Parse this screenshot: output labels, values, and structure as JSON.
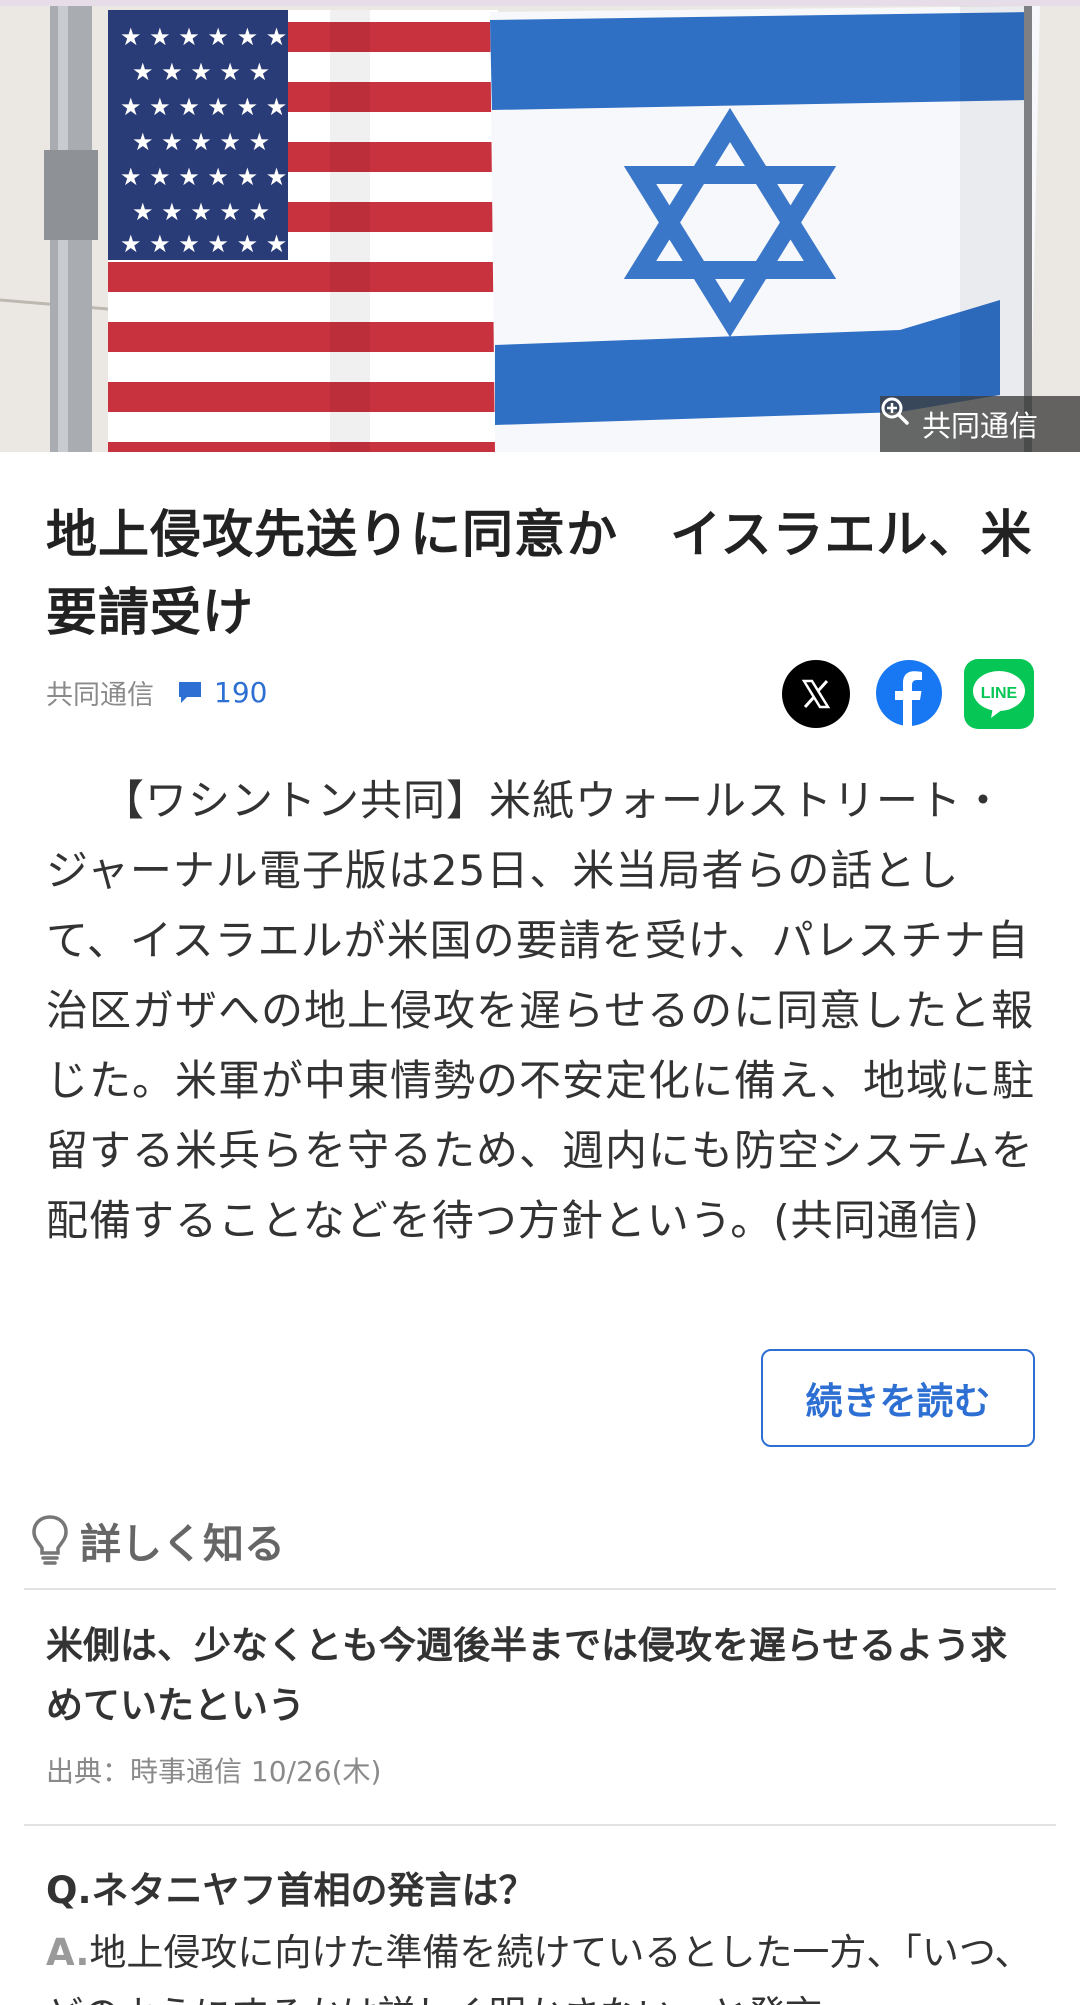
{
  "hero": {
    "credit": "共同通信",
    "colors": {
      "us_red": "#c8323e",
      "us_blue": "#2a3c78",
      "israel_blue": "#2f6fc4"
    }
  },
  "article": {
    "title": "地上侵攻先送りに同意か　イスラエル、米要請受け",
    "source": "共同通信",
    "comment_count": "190",
    "body": "【ワシントン共同】米紙ウォールストリート・ジャーナル電子版は25日、米当局者らの話として、イスラエルが米国の要請を受け、パレスチナ自治区ガザへの地上侵攻を遅らせるのに同意したと報じた。米軍が中東情勢の不安定化に備え、地域に駐留する米兵らを守るため、週内にも防空システムを配備することなどを待つ方針という。(共同通信)",
    "read_more": "続きを読む"
  },
  "share": {
    "line_label": "LINE"
  },
  "learn_more": {
    "heading": "詳しく知る",
    "related": {
      "title": "米側は、少なくとも今週後半までは侵攻を遅らせるよう求めていたという",
      "source": "出典：時事通信 10/26(木)"
    },
    "qa": {
      "question": "Q.ネタニヤフ首相の発言は？",
      "answer_label": "A.",
      "answer": "地上侵攻に向けた準備を続けているとした一方、「いつ、どのようにするかは詳しく明かさない」と発言"
    }
  },
  "accent_color": "#2d6fd2"
}
